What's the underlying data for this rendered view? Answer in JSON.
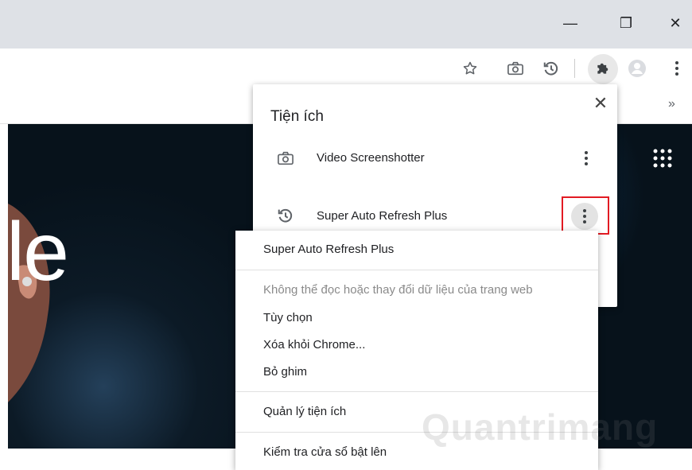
{
  "window": {
    "minimize_glyph": "—",
    "restore_glyph": "❐",
    "close_glyph": "✕"
  },
  "toolbar": {
    "icons": [
      "star-icon",
      "camera-icon",
      "refresh-history-icon",
      "puzzle-icon",
      "profile-icon",
      "kebab-icon"
    ]
  },
  "bookmarks": {
    "overflow": "»"
  },
  "page": {
    "big_text": "le"
  },
  "extensions_popup": {
    "title": "Tiện ích",
    "close_glyph": "✕",
    "items": [
      {
        "name": "Video Screenshotter",
        "icon": "camera-icon"
      },
      {
        "name": "Super Auto Refresh Plus",
        "icon": "refresh-history-icon"
      }
    ]
  },
  "context_menu": {
    "header": "Super Auto Refresh Plus",
    "permission": "Không thể đọc hoặc thay đổi dữ liệu của trang web",
    "options": "Tùy chọn",
    "remove": "Xóa khỏi Chrome...",
    "unpin": "Bỏ ghim",
    "manage": "Quản lý tiện ích",
    "inspect": "Kiểm tra cửa sổ bật lên"
  },
  "watermark": "Quantrimang",
  "colors": {
    "titlebar": "#dee1e6",
    "highlight_box": "#e21b23"
  }
}
